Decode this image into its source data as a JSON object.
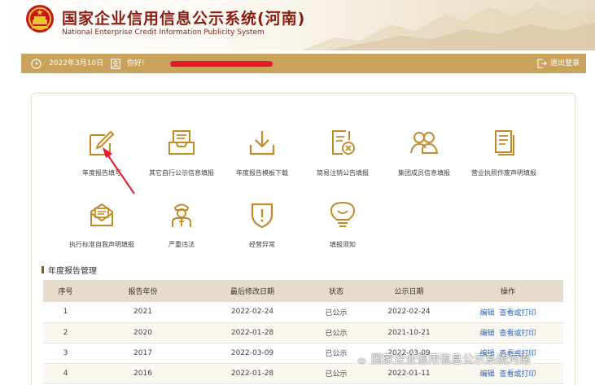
{
  "header": {
    "title": "国家企业信用信息公示系统(河南)",
    "subtitle": "National Enterprise Credit Information Publicity System"
  },
  "infobar": {
    "date": "2022年3月10日",
    "greeting": "你好!",
    "logout": "退出登录"
  },
  "functions": [
    {
      "label": "年度报告填写",
      "icon": "edit-icon"
    },
    {
      "label": "其它自行公示信息填报",
      "icon": "inbox-icon"
    },
    {
      "label": "年度报告模板下载",
      "icon": "download-icon"
    },
    {
      "label": "简易注销公告填报",
      "icon": "cancel-notice-icon"
    },
    {
      "label": "集团成员信息填报",
      "icon": "group-icon"
    },
    {
      "label": "营业执照作废声明填报",
      "icon": "document-icon"
    },
    {
      "label": "执行标准自我声明填报",
      "icon": "mail-icon"
    },
    {
      "label": "严重违法",
      "icon": "officer-icon"
    },
    {
      "label": "经营异常",
      "icon": "warning-shield-icon"
    },
    {
      "label": "填报须知",
      "icon": "bulb-icon"
    }
  ],
  "section": {
    "title": "年度报告管理"
  },
  "table": {
    "headers": [
      "序号",
      "报告年份",
      "最后修改日期",
      "状态",
      "公示日期",
      "操作"
    ],
    "rows": [
      {
        "no": "1",
        "year": "2021",
        "modified": "2022-02-24",
        "status": "已公示",
        "published": "2022-02-24"
      },
      {
        "no": "2",
        "year": "2020",
        "modified": "2022-01-28",
        "status": "已公示",
        "published": "2021-10-21"
      },
      {
        "no": "3",
        "year": "2017",
        "modified": "2022-03-09",
        "status": "已公示",
        "published": "2022-03-09"
      },
      {
        "no": "4",
        "year": "2016",
        "modified": "2022-01-28",
        "status": "已公示",
        "published": "2022-01-11"
      }
    ],
    "op_edit": "编辑",
    "op_view": "查看或打印"
  },
  "watermark": {
    "text": "国家企业信用信息公示系统河南"
  },
  "colors": {
    "brand_red": "#8a1d12",
    "gold": "#c9a25c",
    "link": "#2e67c4",
    "annotation_red": "#e8192c"
  }
}
